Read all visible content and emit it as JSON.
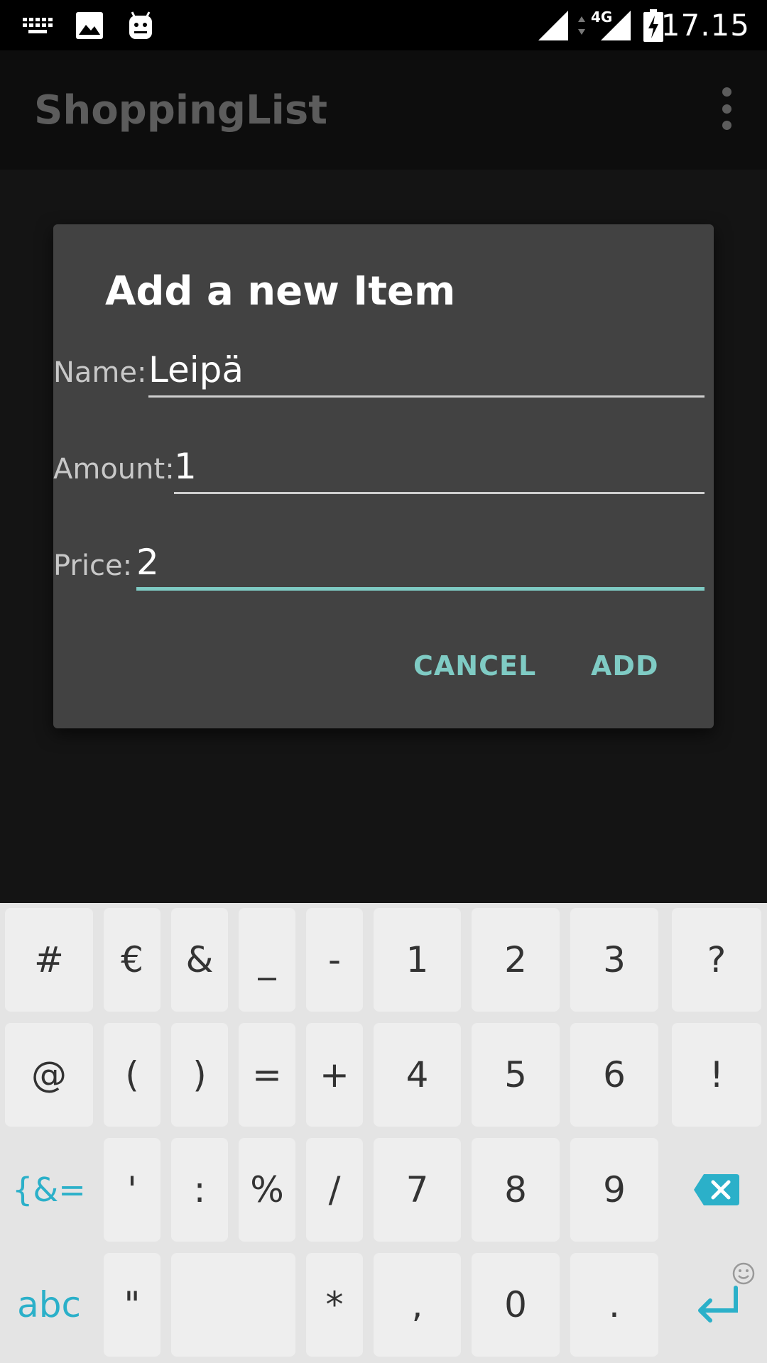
{
  "status_bar": {
    "time": "17.15",
    "network": "4G",
    "icons": [
      "keyboard-icon",
      "image-icon",
      "android-icon",
      "signal-icon",
      "battery-charging-icon"
    ]
  },
  "app_bar": {
    "title": "ShoppingList",
    "menu_icon": "overflow-menu-icon"
  },
  "dialog": {
    "title": "Add a new Item",
    "fields": {
      "name": {
        "label": "Name:",
        "value": "Leipä"
      },
      "amount": {
        "label": "Amount:",
        "value": "1"
      },
      "price": {
        "label": "Price:",
        "value": "2"
      }
    },
    "buttons": {
      "cancel": "CANCEL",
      "add": "ADD"
    }
  },
  "keyboard": {
    "rows": [
      [
        "#",
        "€",
        "&",
        "_",
        "-",
        "1",
        "2",
        "3",
        "?"
      ],
      [
        "@",
        "(",
        ")",
        "=",
        "+",
        "4",
        "5",
        "6",
        "!"
      ],
      [
        "{&=",
        "'",
        ":",
        "%",
        "/",
        "7",
        "8",
        "9"
      ],
      [
        "abc",
        "\"",
        "*",
        ",",
        "0",
        "."
      ]
    ],
    "accent_color": "#2bb0c9",
    "icons": [
      "backspace-icon",
      "emoji-icon",
      "enter-icon"
    ]
  },
  "colors": {
    "accent": "#7fcbc4",
    "dialog_bg": "#424242",
    "keyboard_bg": "#e4e4e4"
  }
}
